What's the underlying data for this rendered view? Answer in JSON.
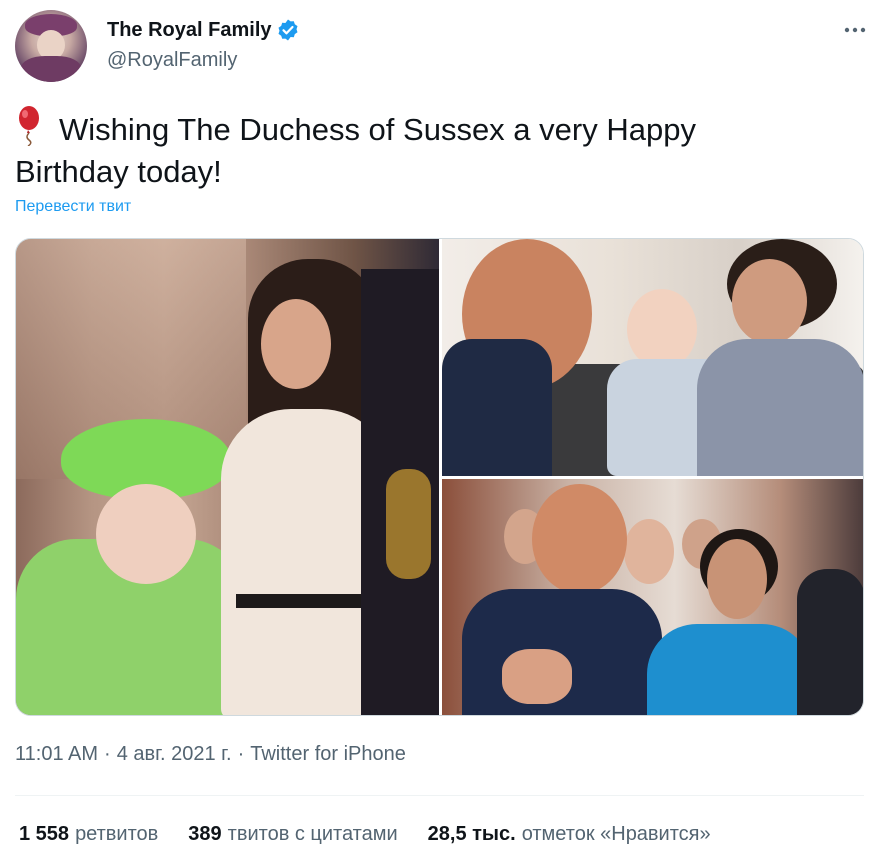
{
  "author": {
    "display_name": "The Royal Family",
    "handle": "@RoyalFamily",
    "verified": true,
    "avatar_icon": "portrait-avatar"
  },
  "tweet": {
    "emoji_icon": "balloon-icon",
    "text": "Wishing The Duchess of Sussex a very Happy Birthday today!",
    "translate_label": "Перевести твит"
  },
  "media": {
    "photos": [
      {
        "description_icon": "photo-duchess-and-queen"
      },
      {
        "description_icon": "photo-family-with-baby"
      },
      {
        "description_icon": "photo-couple-applauding"
      }
    ]
  },
  "meta": {
    "time": "11:01 AM",
    "date": "4 авг. 2021 г.",
    "separator": "·",
    "source": "Twitter for iPhone"
  },
  "stats": {
    "retweets_count": "1 558",
    "retweets_label": "ретвитов",
    "quotes_count": "389",
    "quotes_label": "твитов с цитатами",
    "likes_count": "28,5 тыс.",
    "likes_label": "отметок «Нравится»"
  },
  "colors": {
    "link_blue": "#1d9bf0",
    "secondary_text": "#536471",
    "primary_text": "#0f1419",
    "verified_blue": "#1d9bf0"
  }
}
